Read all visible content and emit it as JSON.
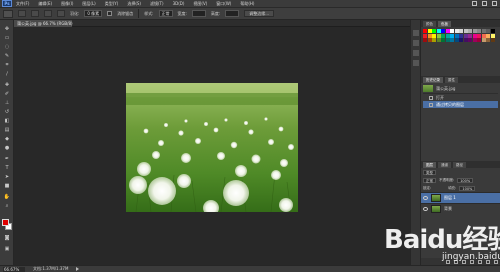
{
  "menubar": {
    "logo": "Ps",
    "items": [
      "文件(F)",
      "编辑(E)",
      "图像(I)",
      "图层(L)",
      "类型(Y)",
      "选择(S)",
      "滤镜(T)",
      "3D(D)",
      "视图(V)",
      "窗口(W)",
      "帮助(H)"
    ]
  },
  "options": {
    "feather_label": "羽化:",
    "feather_value": "0 像素",
    "antialias_label": "消除锯齿",
    "style_label": "样式:",
    "style_value": "正常",
    "width_label": "宽度:",
    "height_label": "高度:",
    "refine_edge": "调整边缘..."
  },
  "document": {
    "tab_title": "蒲公英.jpg @ 66.7% (RGB/8)"
  },
  "status": {
    "zoom": "66.67%",
    "doc_info": "文档:1.37M/1.37M"
  },
  "panels": {
    "swatch_tabs": [
      "颜色",
      "色板"
    ],
    "history_tabs": [
      "历史记录",
      "属性"
    ],
    "history_doc": "蒲公英.jpg",
    "history_items": [
      "打开",
      "通过拷贝的图层"
    ],
    "layers_tabs": [
      "图层",
      "通道",
      "路径"
    ],
    "kind_label": "类型",
    "blend_mode": "正常",
    "opacity_label": "不透明度:",
    "opacity_value": "100%",
    "lock_label": "锁定:",
    "fill_label": "填充:",
    "fill_value": "100%",
    "layers": [
      "图层 1",
      "背景"
    ]
  },
  "watermark": {
    "brand": "Baidu经验",
    "url": "jingyan.baidu.com"
  },
  "colors": {
    "foreground": "#e00000",
    "background": "#ffffff",
    "selection": "#4a6fa5"
  }
}
